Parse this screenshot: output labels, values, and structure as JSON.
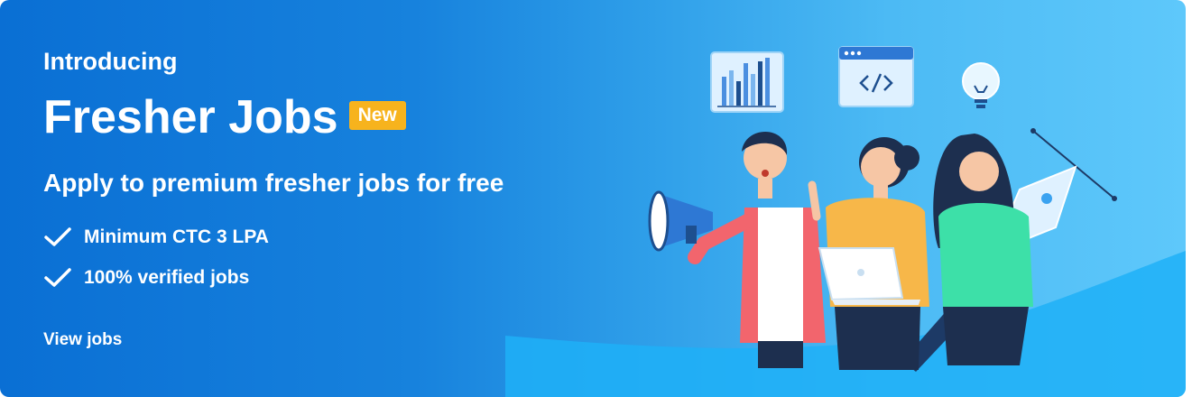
{
  "banner": {
    "intro": "Introducing",
    "title": "Fresher Jobs",
    "badge": "New",
    "subtitle": "Apply to premium fresher jobs for free",
    "features": [
      {
        "label": "Minimum CTC 3 LPA"
      },
      {
        "label": "100% verified jobs"
      }
    ],
    "cta": "View jobs"
  },
  "colors": {
    "gradient_start": "#0a6fd4",
    "gradient_end": "#5ec8fb",
    "badge": "#f7b31d",
    "text": "#ffffff"
  },
  "illustration": {
    "icons": [
      "bar-chart-icon",
      "code-window-icon",
      "lightbulb-icon",
      "megaphone-icon",
      "laptop-icon",
      "pen-nib-icon"
    ]
  }
}
